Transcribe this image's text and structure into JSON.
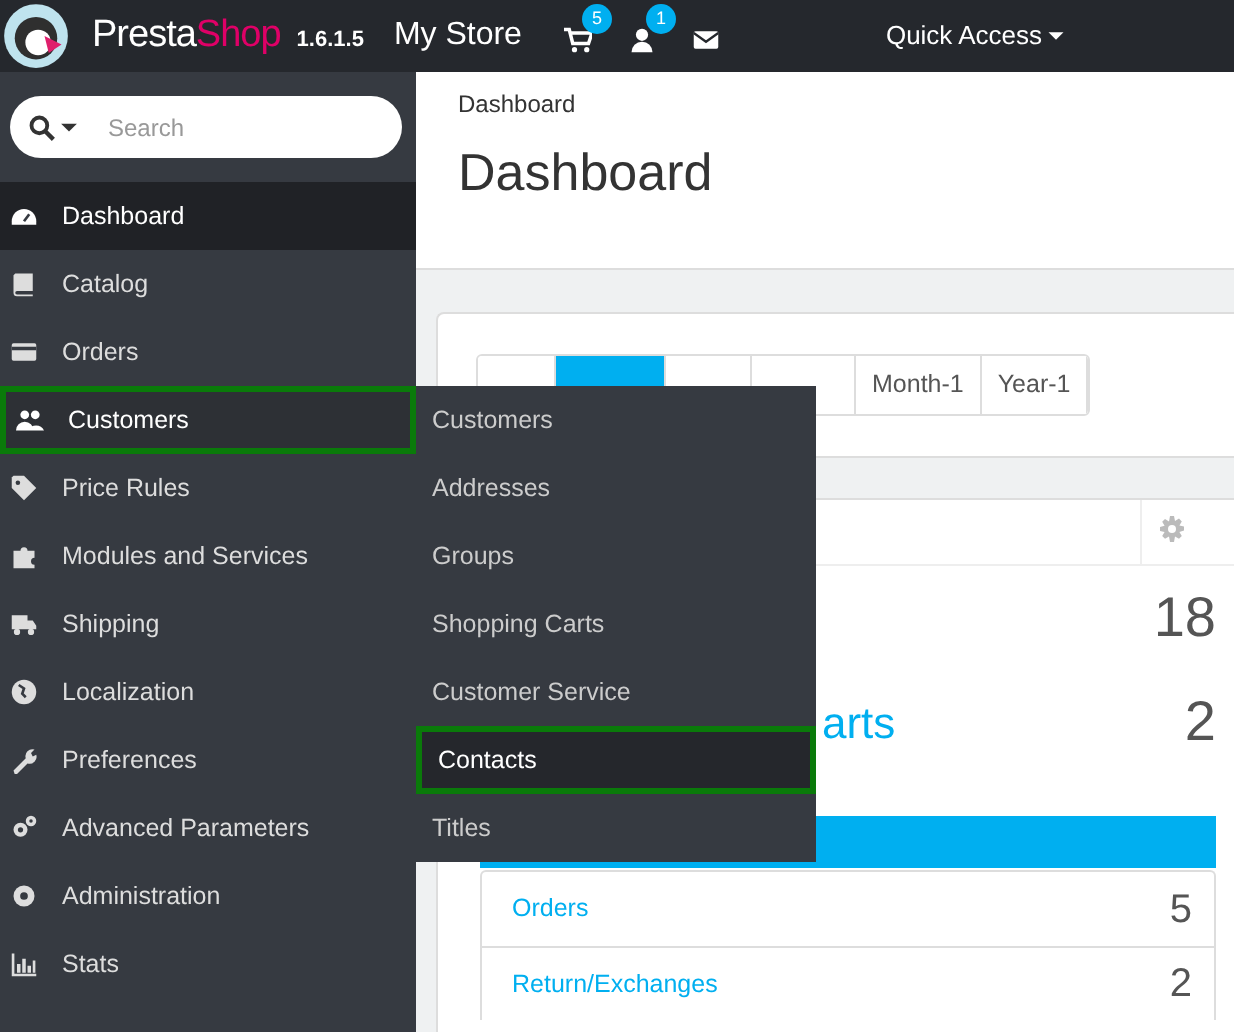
{
  "header": {
    "brand": "Presta",
    "brand_accent": "Shop",
    "version": "1.6.1.5",
    "store": "My Store",
    "notifications": [
      {
        "kind": "cart",
        "count": "5"
      },
      {
        "kind": "user",
        "count": "1"
      },
      {
        "kind": "mail"
      }
    ],
    "quick_access": "Quick Access"
  },
  "search": {
    "placeholder": "Search"
  },
  "sidebar": {
    "items": [
      {
        "kind": "dashboard",
        "label": "Dashboard",
        "selected": true,
        "outlined": false
      },
      {
        "kind": "book",
        "label": "Catalog",
        "selected": false,
        "outlined": false
      },
      {
        "kind": "card",
        "label": "Orders",
        "selected": false,
        "outlined": false
      },
      {
        "kind": "users",
        "label": "Customers",
        "selected": false,
        "outlined": true,
        "submenu": [
          {
            "label": "Customers",
            "selected": false,
            "outlined": false
          },
          {
            "label": "Addresses",
            "selected": false,
            "outlined": false
          },
          {
            "label": "Groups",
            "selected": false,
            "outlined": false
          },
          {
            "label": "Shopping Carts",
            "selected": false,
            "outlined": false
          },
          {
            "label": "Customer Service",
            "selected": false,
            "outlined": false
          },
          {
            "label": "Contacts",
            "selected": true,
            "outlined": true
          },
          {
            "label": "Titles",
            "selected": false,
            "outlined": false
          }
        ]
      },
      {
        "kind": "tag",
        "label": "Price Rules",
        "selected": false,
        "outlined": false
      },
      {
        "kind": "puzzle",
        "label": "Modules and Services",
        "selected": false,
        "outlined": false
      },
      {
        "kind": "truck",
        "label": "Shipping",
        "selected": false,
        "outlined": false
      },
      {
        "kind": "globe",
        "label": "Localization",
        "selected": false,
        "outlined": false
      },
      {
        "kind": "wrench",
        "label": "Preferences",
        "selected": false,
        "outlined": false
      },
      {
        "kind": "gears",
        "label": "Advanced Parameters",
        "selected": false,
        "outlined": false
      },
      {
        "kind": "gear",
        "label": "Administration",
        "selected": false,
        "outlined": false
      },
      {
        "kind": "chart",
        "label": "Stats",
        "selected": false,
        "outlined": false
      }
    ]
  },
  "page": {
    "breadcrumb": "Dashboard",
    "title": "Dashboard"
  },
  "periods": [
    {
      "selected": false
    },
    {
      "selected": true
    },
    {
      "selected": false
    },
    {
      "selected": false
    },
    {
      "label": "Month-1",
      "selected": false
    },
    {
      "label": "Year-1",
      "selected": false
    }
  ],
  "activity": {
    "rows": [
      {
        "value": "18"
      },
      {
        "label": "arts",
        "value": "2"
      }
    ],
    "list": [
      {
        "label": "Orders",
        "value": "5"
      },
      {
        "label": "Return/Exchanges",
        "value": "2"
      }
    ]
  }
}
